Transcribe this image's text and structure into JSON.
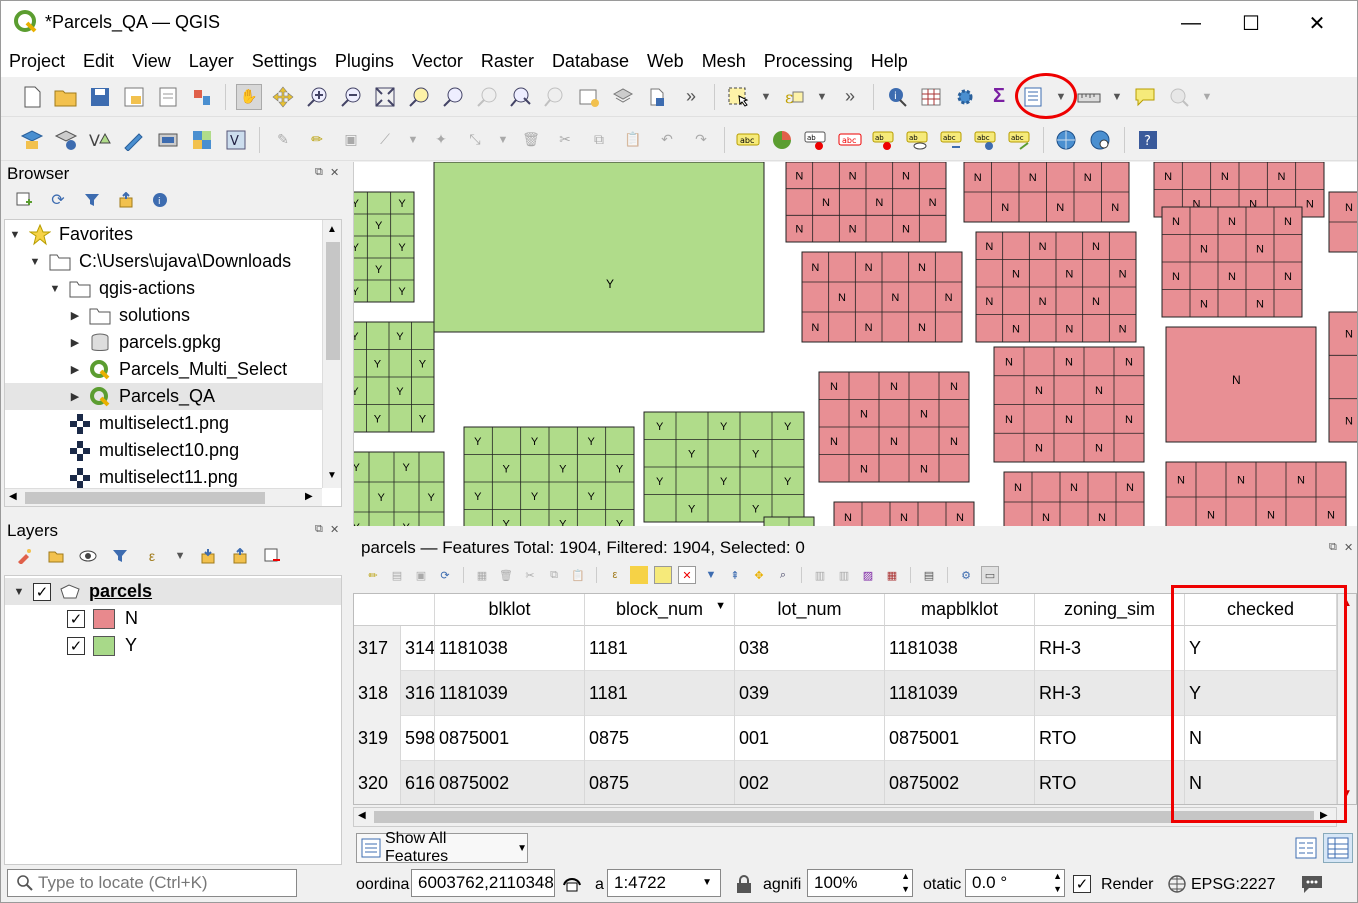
{
  "window": {
    "title": "*Parcels_QA — QGIS",
    "minimize": "—",
    "maximize": "☐",
    "close": "✕"
  },
  "menu": [
    "Project",
    "Edit",
    "View",
    "Layer",
    "Settings",
    "Plugins",
    "Vector",
    "Raster",
    "Database",
    "Web",
    "Mesh",
    "Processing",
    "Help"
  ],
  "browser": {
    "title": "Browser",
    "items": [
      {
        "label": "Favorites",
        "icon": "star-icon"
      },
      {
        "label": "C:\\Users\\ujava\\Downloads",
        "icon": "folder-icon"
      },
      {
        "label": "qgis-actions",
        "icon": "folder-icon"
      },
      {
        "label": "solutions",
        "icon": "folder-icon"
      },
      {
        "label": "parcels.gpkg",
        "icon": "database-icon"
      },
      {
        "label": "Parcels_Multi_Select",
        "icon": "qgis-project-icon"
      },
      {
        "label": "Parcels_QA",
        "icon": "qgis-project-icon"
      },
      {
        "label": "multiselect1.png",
        "icon": "raster-icon"
      },
      {
        "label": "multiselect10.png",
        "icon": "raster-icon"
      },
      {
        "label": "multiselect11.png",
        "icon": "raster-icon"
      }
    ]
  },
  "layers": {
    "title": "Layers",
    "layer_name": "parcels",
    "categories": [
      {
        "label": "N",
        "color": "#e8898d"
      },
      {
        "label": "Y",
        "color": "#a8d989"
      }
    ]
  },
  "map": {
    "fill_n": "#e88f94",
    "fill_y": "#b0dc8a",
    "label_n": "N",
    "label_y": "Y"
  },
  "attribute_table": {
    "title": "parcels — Features Total: 1904, Filtered: 1904, Selected: 0",
    "columns": [
      "blklot",
      "block_num",
      "lot_num",
      "mapblklot",
      "zoning_sim",
      "checked"
    ],
    "rows": [
      {
        "row": "317",
        "id": "314",
        "blklot": "1181038",
        "block_num": "1181",
        "lot_num": "038",
        "mapblklot": "1181038",
        "zoning_sim": "RH-3",
        "checked": "Y"
      },
      {
        "row": "318",
        "id": "316",
        "blklot": "1181039",
        "block_num": "1181",
        "lot_num": "039",
        "mapblklot": "1181039",
        "zoning_sim": "RH-3",
        "checked": "Y"
      },
      {
        "row": "319",
        "id": "598",
        "blklot": "0875001",
        "block_num": "0875",
        "lot_num": "001",
        "mapblklot": "0875001",
        "zoning_sim": "RTO",
        "checked": "N"
      },
      {
        "row": "320",
        "id": "616",
        "blklot": "0875002",
        "block_num": "0875",
        "lot_num": "002",
        "mapblklot": "0875002",
        "zoning_sim": "RTO",
        "checked": "N"
      }
    ],
    "show_features": "Show All Features"
  },
  "status": {
    "locator_placeholder": "Type to locate (Ctrl+K)",
    "coord_label": "oordina",
    "coord_value": "6003762,2110348",
    "scale_label": "a",
    "scale_value": "1:4722",
    "magnifier_label": "agnifi",
    "magnifier_value": "100%",
    "rotation_label": "otatic",
    "rotation_value": "0.0 °",
    "render_label": "Render",
    "crs": "EPSG:2227"
  }
}
